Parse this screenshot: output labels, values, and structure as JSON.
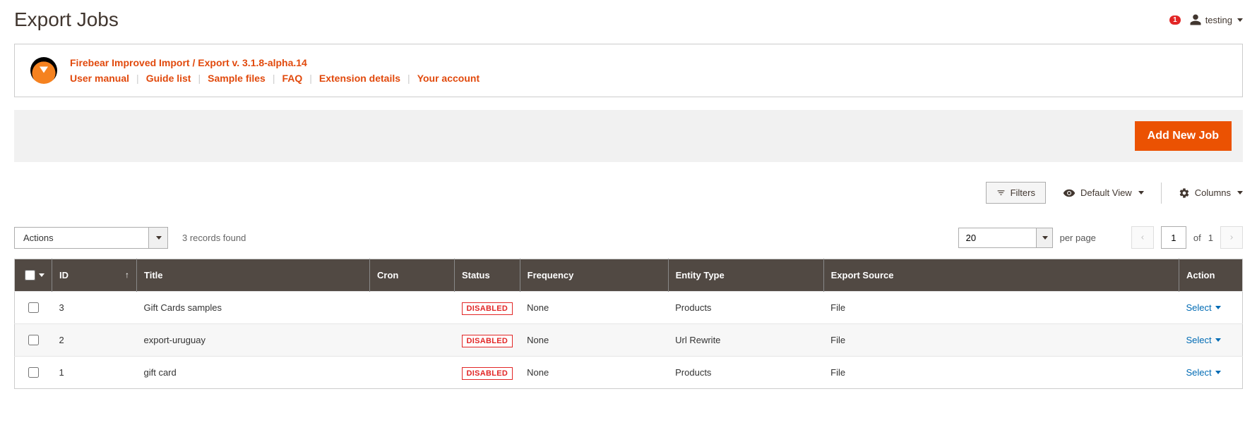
{
  "header": {
    "title": "Export Jobs",
    "notification_count": "1",
    "user_label": "testing"
  },
  "info_panel": {
    "title": "Firebear Improved Import / Export v. 3.1.8-alpha.14",
    "links": [
      "User manual",
      "Guide list",
      "Sample files",
      "FAQ",
      "Extension details",
      "Your account"
    ]
  },
  "actions": {
    "add_new_label": "Add New Job"
  },
  "toolbar": {
    "filters_label": "Filters",
    "default_view_label": "Default View",
    "columns_label": "Columns"
  },
  "grid_controls": {
    "actions_label": "Actions",
    "records_found": "3 records found",
    "per_page_value": "20",
    "per_page_label": "per page",
    "current_page": "1",
    "of_label": "of",
    "total_pages": "1"
  },
  "columns": {
    "id": "ID",
    "title": "Title",
    "cron": "Cron",
    "status": "Status",
    "frequency": "Frequency",
    "entity_type": "Entity Type",
    "export_source": "Export Source",
    "action": "Action"
  },
  "rows": [
    {
      "id": "3",
      "title": "Gift Cards samples",
      "cron": "",
      "status": "DISABLED",
      "frequency": "None",
      "entity_type": "Products",
      "export_source": "File",
      "action": "Select"
    },
    {
      "id": "2",
      "title": "export-uruguay",
      "cron": "",
      "status": "DISABLED",
      "frequency": "None",
      "entity_type": "Url Rewrite",
      "export_source": "File",
      "action": "Select"
    },
    {
      "id": "1",
      "title": "gift card",
      "cron": "",
      "status": "DISABLED",
      "frequency": "None",
      "entity_type": "Products",
      "export_source": "File",
      "action": "Select"
    }
  ]
}
